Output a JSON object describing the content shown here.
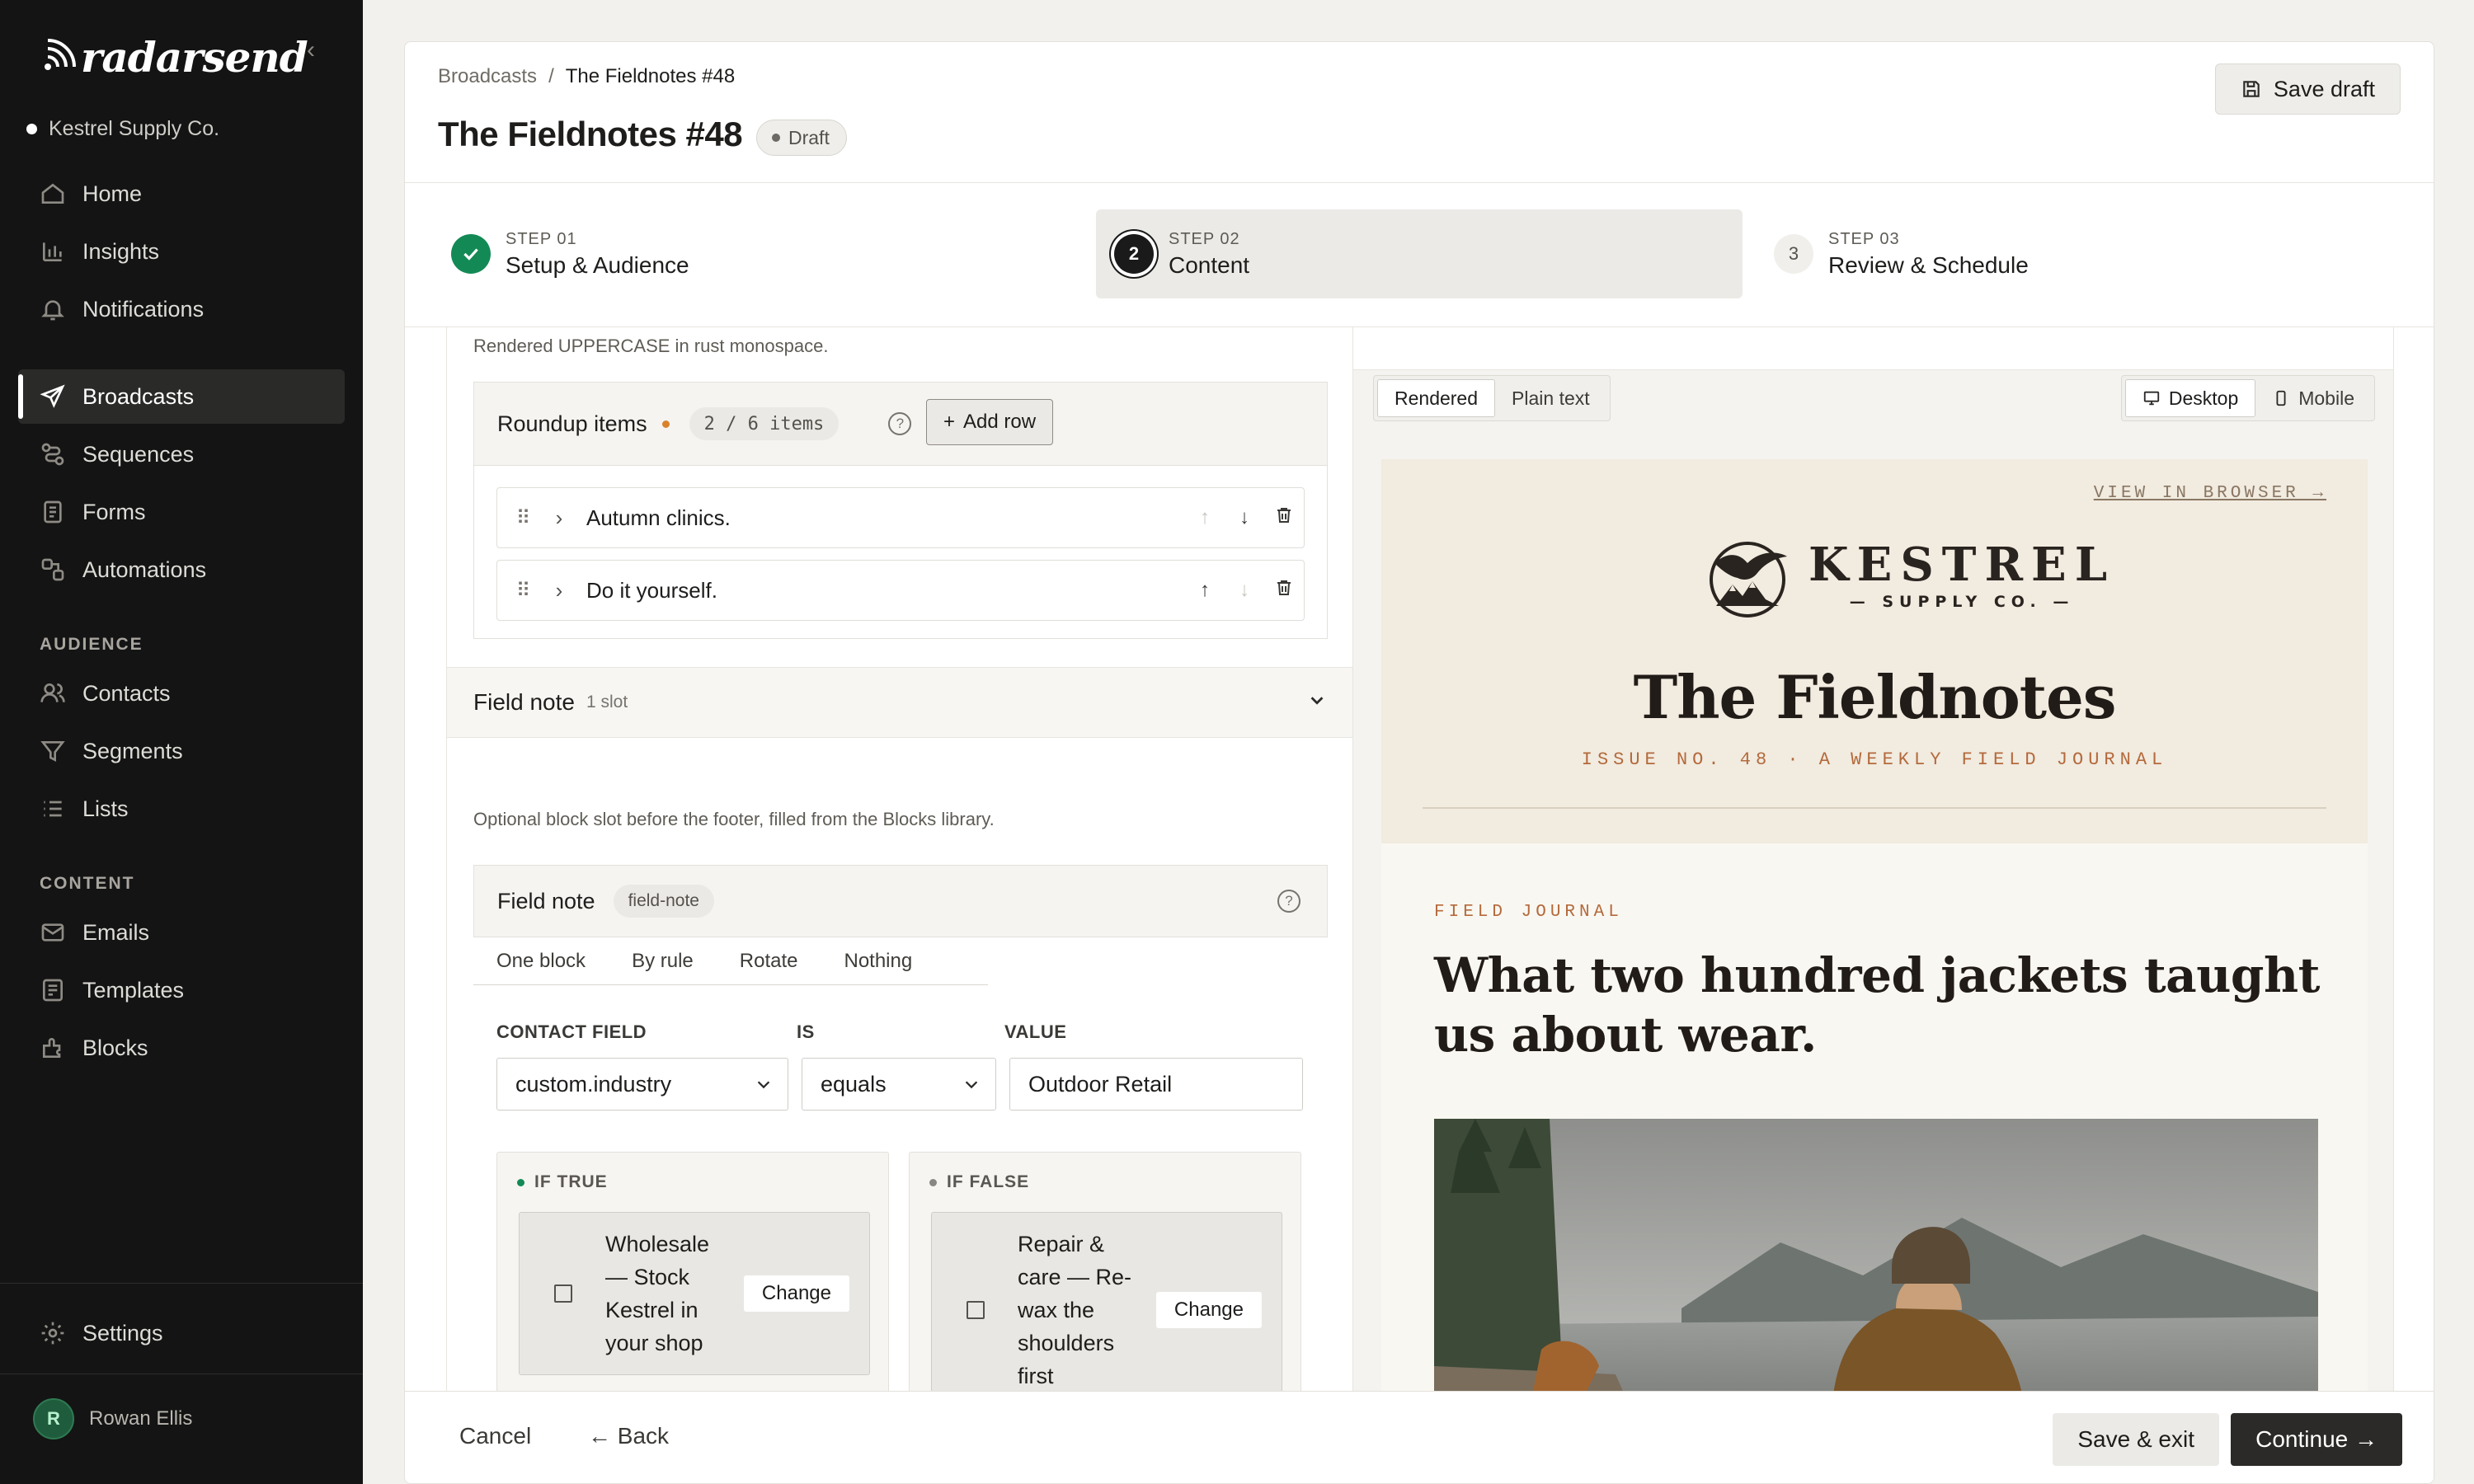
{
  "app": {
    "brand": "radarsend",
    "org": "Kestrel Supply Co."
  },
  "sidebar": {
    "items": [
      {
        "label": "Home",
        "icon": "home-icon"
      },
      {
        "label": "Insights",
        "icon": "bar-chart-icon"
      },
      {
        "label": "Notifications",
        "icon": "bell-icon"
      },
      {
        "label": "Broadcasts",
        "icon": "send-icon",
        "active": true
      },
      {
        "label": "Sequences",
        "icon": "sequence-icon"
      },
      {
        "label": "Forms",
        "icon": "form-icon"
      },
      {
        "label": "Automations",
        "icon": "automation-icon"
      }
    ],
    "audience_title": "AUDIENCE",
    "audience": [
      {
        "label": "Contacts",
        "icon": "contacts-icon"
      },
      {
        "label": "Segments",
        "icon": "filter-icon"
      },
      {
        "label": "Lists",
        "icon": "list-icon"
      }
    ],
    "content_title": "CONTENT",
    "content": [
      {
        "label": "Emails",
        "icon": "mail-icon"
      },
      {
        "label": "Templates",
        "icon": "template-icon"
      },
      {
        "label": "Blocks",
        "icon": "blocks-icon"
      }
    ],
    "settings": "Settings",
    "user": {
      "initial": "R",
      "name": "Rowan Ellis"
    }
  },
  "header": {
    "breadcrumb_root": "Broadcasts",
    "breadcrumb_sep": "/",
    "breadcrumb_current": "The Fieldnotes #48",
    "title": "The Fieldnotes #48",
    "status": "Draft",
    "save_draft": "Save draft"
  },
  "steps": [
    {
      "label": "STEP 01",
      "name": "Setup & Audience",
      "state": "done"
    },
    {
      "label": "STEP 02",
      "name": "Content",
      "state": "current",
      "num": "2"
    },
    {
      "label": "STEP 03",
      "name": "Review & Schedule",
      "state": "todo",
      "num": "3"
    }
  ],
  "editor": {
    "hint_top": "Rendered UPPERCASE in rust monospace.",
    "roundup": {
      "title": "Roundup items",
      "count": "2 / 6 items",
      "add_row": "Add row",
      "items": [
        "Autumn clinics.",
        "Do it yourself."
      ]
    },
    "field_note_section": {
      "title": "Field note",
      "slot": "1 slot"
    },
    "field_note_hint": "Optional block slot before the footer, filled from the Blocks library.",
    "field_note_card": {
      "title": "Field note",
      "key": "field-note"
    },
    "mode_tabs": [
      "One block",
      "By rule",
      "Rotate",
      "Nothing"
    ],
    "rule": {
      "contact_field_label": "CONTACT FIELD",
      "contact_field_value": "custom.industry",
      "is_label": "IS",
      "is_value": "equals",
      "value_label": "VALUE",
      "value_value": "Outdoor Retail"
    },
    "if_true": {
      "label": "IF TRUE",
      "block": "Wholesale — Stock Kestrel in your shop",
      "change": "Change"
    },
    "if_false": {
      "label": "IF FALSE",
      "block": "Repair & care — Re-wax the shoulders first",
      "change": "Change"
    }
  },
  "preview": {
    "view_tabs": [
      "Rendered",
      "Plain text"
    ],
    "device_tabs": [
      "Desktop",
      "Mobile"
    ],
    "email": {
      "view_in_browser": "VIEW IN BROWSER →",
      "brand_name": "KESTREL",
      "brand_sub": "— SUPPLY CO. —",
      "title": "The Fieldnotes",
      "issue": "ISSUE NO. 48 · A WEEKLY FIELD JOURNAL",
      "kicker": "FIELD JOURNAL",
      "headline": "What two hundred jackets taught us about wear."
    }
  },
  "footer": {
    "cancel": "Cancel",
    "back": "← Back",
    "save_exit": "Save & exit",
    "continue": "Continue →"
  },
  "colors": {
    "accent_success": "#138a55",
    "accent_rust": "#b46a3c",
    "sidebar_bg": "#141414"
  }
}
